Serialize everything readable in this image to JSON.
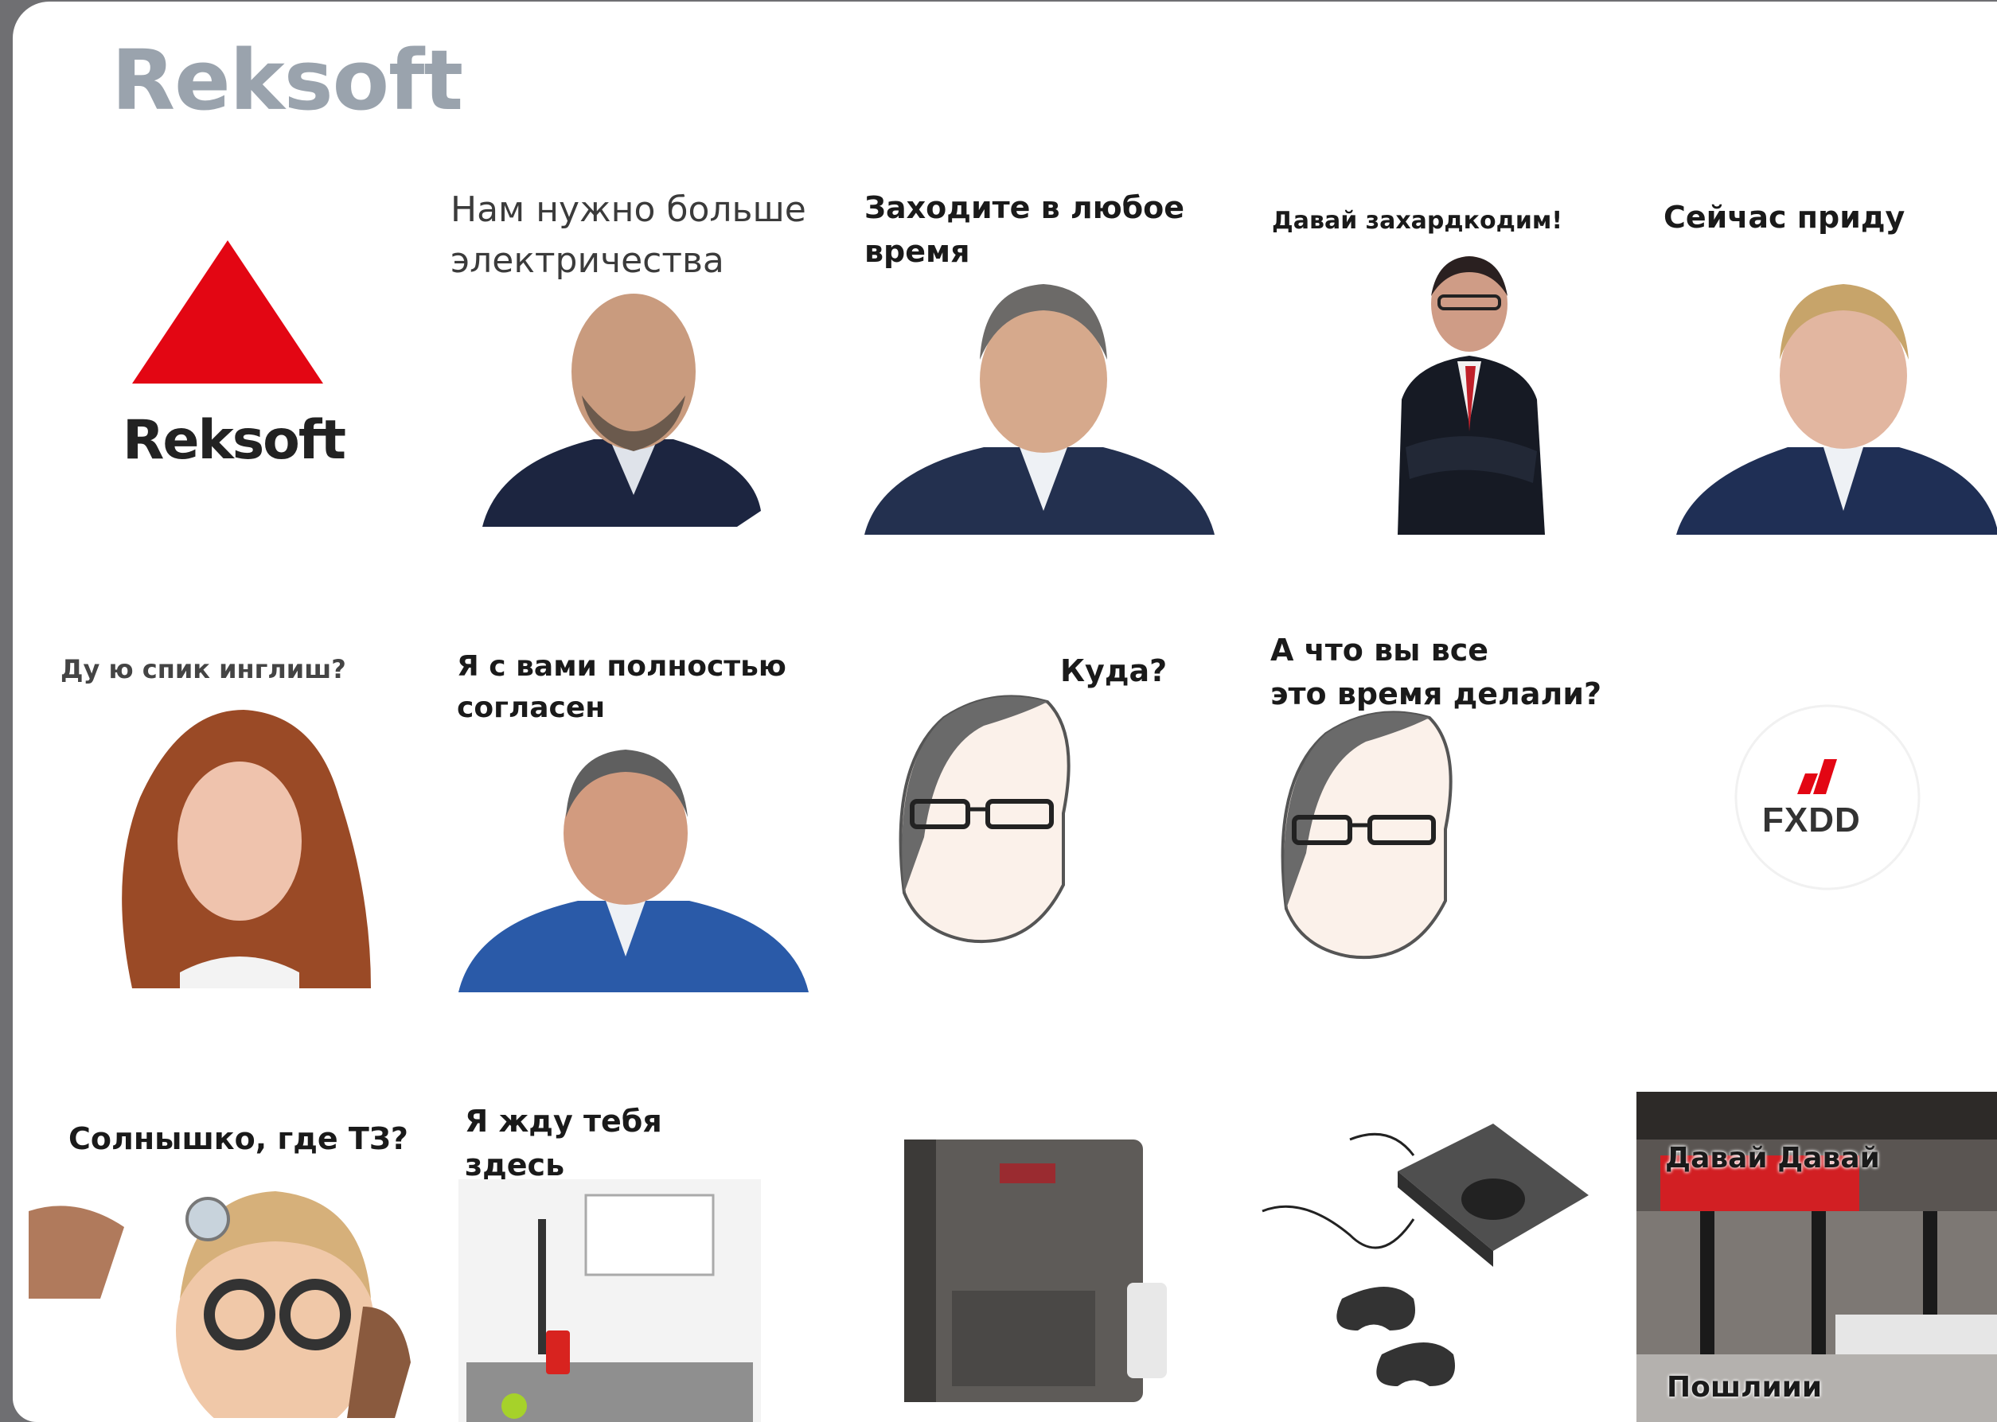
{
  "pack": {
    "title": "Reksoft"
  },
  "stickers": [
    {
      "caption": "",
      "logo_text": "Reksoft"
    },
    {
      "caption": "Нам нужно больше\nэлектричества"
    },
    {
      "caption": "Заходите в любое\nвремя"
    },
    {
      "caption": "Давай захардкодим!"
    },
    {
      "caption": "Сейчас приду"
    },
    {
      "caption": "Ду ю спик инглиш?"
    },
    {
      "caption": "Я с вами полностью\nсогласен"
    },
    {
      "caption": "Куда?"
    },
    {
      "caption": "А что вы все\nэто время делали?"
    },
    {
      "caption": "",
      "logo_text": "FXDD"
    },
    {
      "caption": "Солнышко, где ТЗ?"
    },
    {
      "caption": "Я жду тебя здесь"
    },
    {
      "caption": ""
    },
    {
      "caption": ""
    },
    {
      "caption": "Давай Давай",
      "caption2": "Пошлиии"
    }
  ],
  "colors": {
    "brand_red": "#e30613",
    "title_gray": "#9aa3ad",
    "suit_navy": "#1f2f55"
  }
}
